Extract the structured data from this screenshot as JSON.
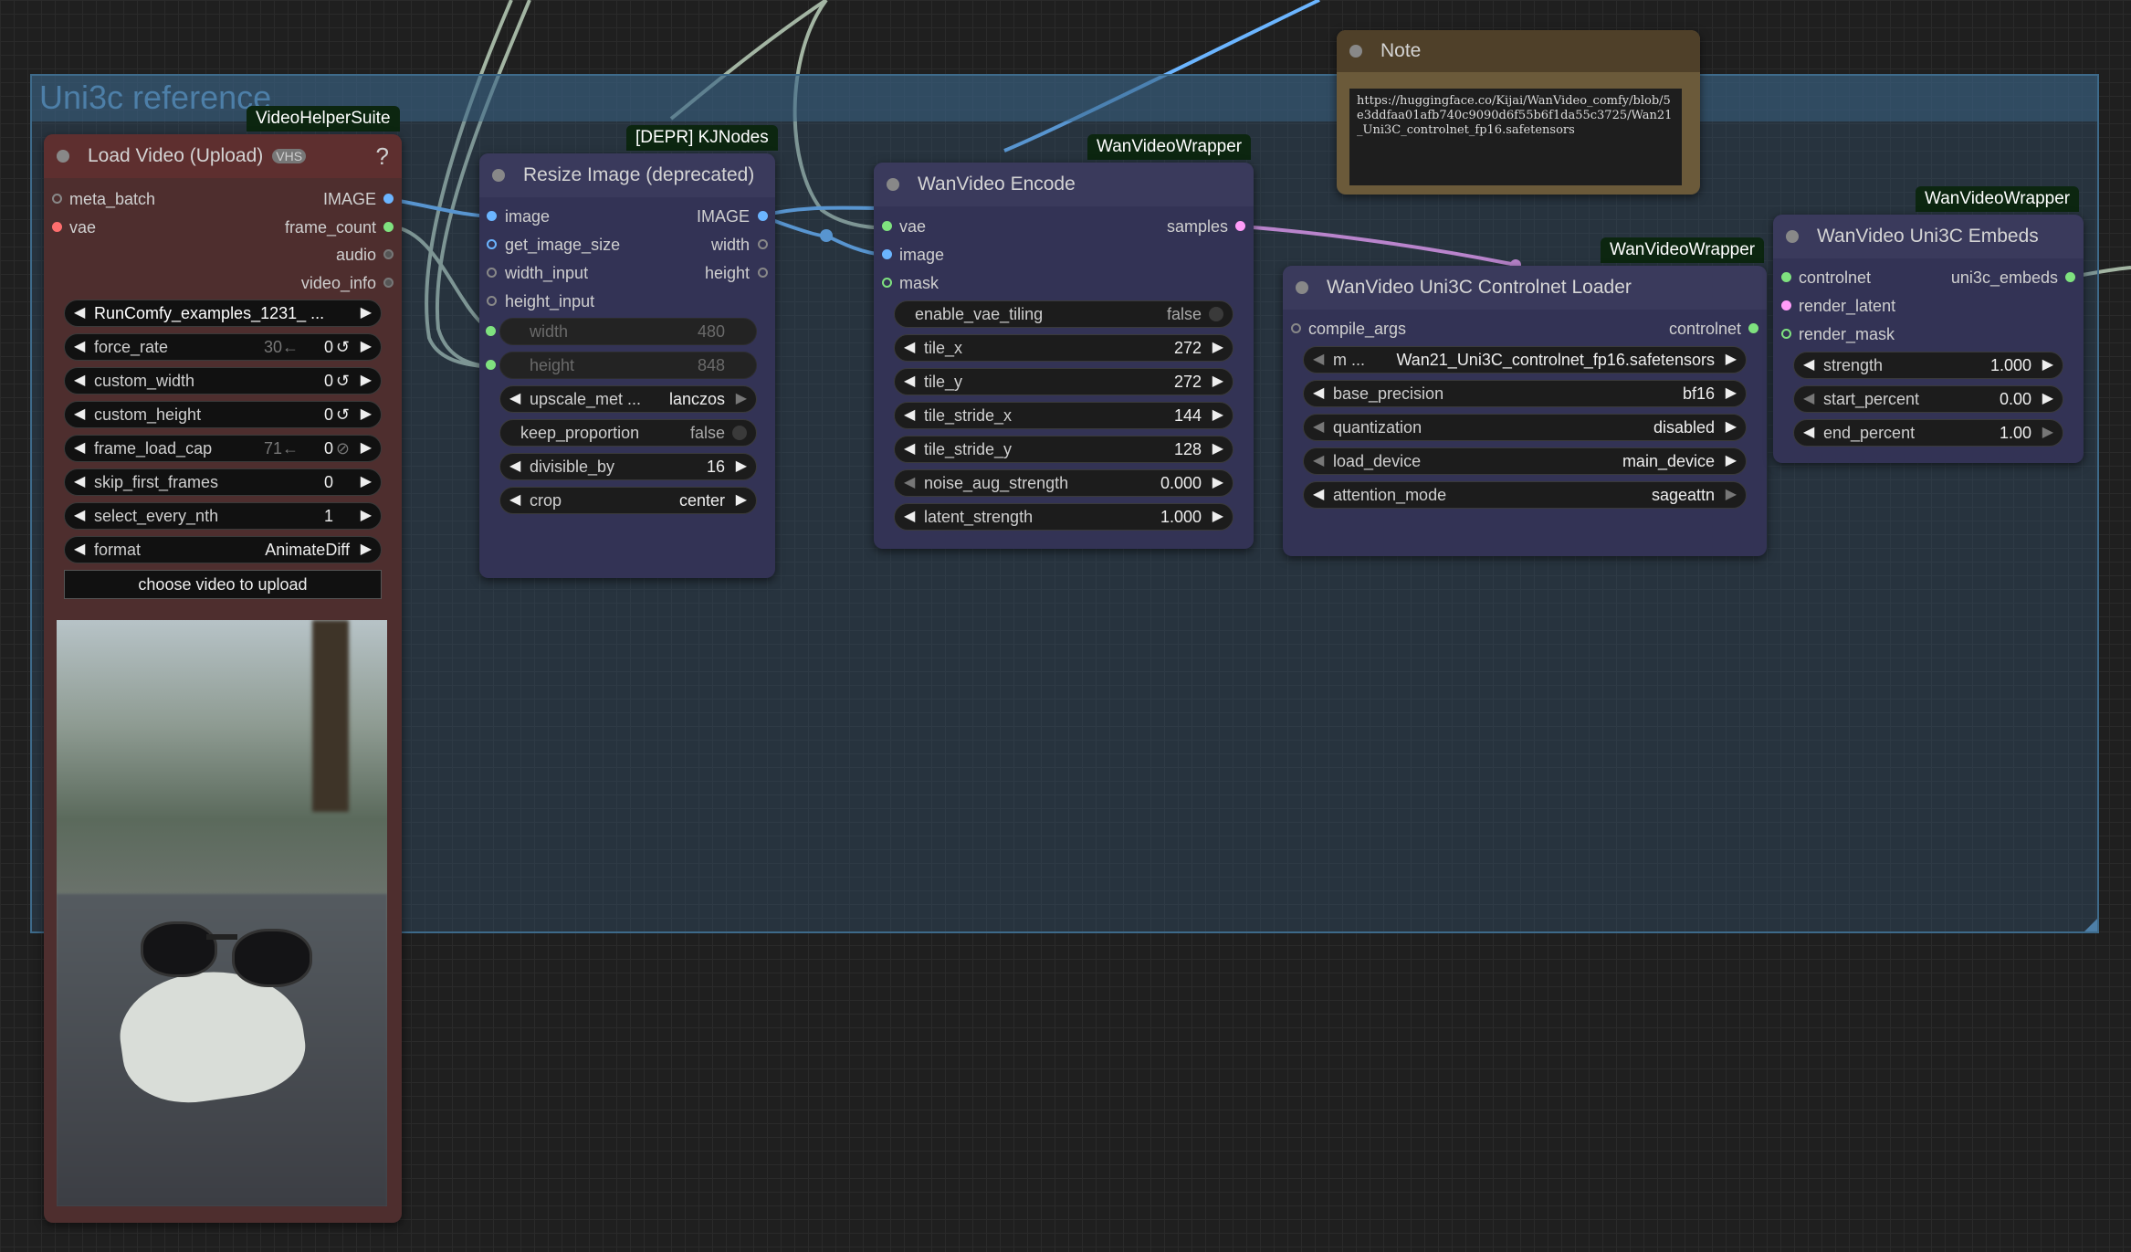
{
  "group": {
    "title": "Uni3c reference"
  },
  "colors": {
    "image": "#6bb5ff",
    "vae": "#ff6e6e",
    "int": "#7fe27f",
    "latent": "#ff9cf9",
    "embeds": "#7fe27f",
    "group_bg": "#3b6486"
  },
  "load_video": {
    "badge": "VideoHelperSuite",
    "title": "Load Video (Upload)",
    "icon_text": "VHS",
    "help": "?",
    "inputs": [
      "meta_batch",
      "vae"
    ],
    "outputs": [
      "IMAGE",
      "frame_count",
      "audio",
      "video_info"
    ],
    "widgets": [
      {
        "label": "",
        "value": "RunComfy_examples_1231_ ..."
      },
      {
        "label": "force_rate",
        "value": "0",
        "hint": "30←"
      },
      {
        "label": "custom_width",
        "value": "0",
        "hint": ""
      },
      {
        "label": "custom_height",
        "value": "0",
        "hint": ""
      },
      {
        "label": "frame_load_cap",
        "value": "0",
        "hint": "71←"
      },
      {
        "label": "skip_first_frames",
        "value": "0",
        "hint": ""
      },
      {
        "label": "select_every_nth",
        "value": "1",
        "hint": ""
      },
      {
        "label": "format",
        "value": "AnimateDiff",
        "hint": ""
      }
    ],
    "upload_button": "choose video to upload"
  },
  "resize": {
    "badge": "[DEPR] KJNodes",
    "title": "Resize Image (deprecated)",
    "inputs": [
      "image",
      "get_image_size",
      "width_input",
      "height_input"
    ],
    "outputs": [
      "IMAGE",
      "width",
      "height"
    ],
    "widgets": [
      {
        "label": "width",
        "value": "480"
      },
      {
        "label": "height",
        "value": "848"
      },
      {
        "label": "upscale_met ...",
        "value": "lanczos"
      },
      {
        "label": "keep_proportion",
        "value": "false"
      },
      {
        "label": "divisible_by",
        "value": "16"
      },
      {
        "label": "crop",
        "value": "center"
      }
    ]
  },
  "encode": {
    "badge": "WanVideoWrapper",
    "title": "WanVideo Encode",
    "inputs": [
      "vae",
      "image",
      "mask"
    ],
    "outputs": [
      "samples"
    ],
    "widgets": [
      {
        "label": "enable_vae_tiling",
        "value": "false"
      },
      {
        "label": "tile_x",
        "value": "272"
      },
      {
        "label": "tile_y",
        "value": "272"
      },
      {
        "label": "tile_stride_x",
        "value": "144"
      },
      {
        "label": "tile_stride_y",
        "value": "128"
      },
      {
        "label": "noise_aug_strength",
        "value": "0.000"
      },
      {
        "label": "latent_strength",
        "value": "1.000"
      }
    ]
  },
  "note": {
    "title": "Note",
    "text": "https://huggingface.co/Kijai/WanVideo_comfy/blob/5e3ddfaa01afb740c9090d6f55b6f1da55c3725/Wan21_Uni3C_controlnet_fp16.safetensors"
  },
  "controlnet_loader": {
    "badge": "WanVideoWrapper",
    "title": "WanVideo Uni3C Controlnet Loader",
    "inputs": [
      "compile_args"
    ],
    "outputs": [
      "controlnet"
    ],
    "widgets": [
      {
        "label": "m ...",
        "value": "Wan21_Uni3C_controlnet_fp16.safetensors"
      },
      {
        "label": "base_precision",
        "value": "bf16"
      },
      {
        "label": "quantization",
        "value": "disabled"
      },
      {
        "label": "load_device",
        "value": "main_device"
      },
      {
        "label": "attention_mode",
        "value": "sageattn"
      }
    ]
  },
  "embeds": {
    "badge": "WanVideoWrapper",
    "title": "WanVideo Uni3C Embeds",
    "inputs": [
      "controlnet",
      "render_latent",
      "render_mask"
    ],
    "outputs": [
      "uni3c_embeds"
    ],
    "widgets": [
      {
        "label": "strength",
        "value": "1.000"
      },
      {
        "label": "start_percent",
        "value": "0.00"
      },
      {
        "label": "end_percent",
        "value": "1.00"
      }
    ]
  }
}
